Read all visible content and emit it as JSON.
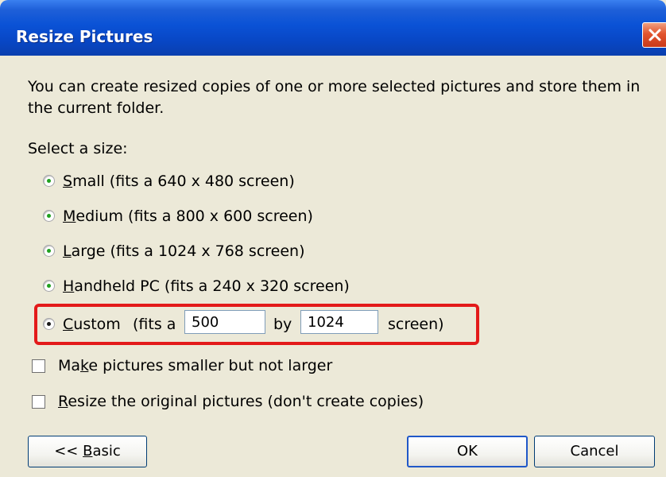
{
  "window": {
    "title": "Resize Pictures",
    "close_icon": "close-icon"
  },
  "description": {
    "line1": "You can create resized copies of one or more selected pictures and store them in",
    "line2": "the current folder."
  },
  "size_section": {
    "heading": "Select a size:",
    "options": [
      {
        "mnemonic": "S",
        "rest": "mall (fits a 640 x 480 screen)",
        "selected": false
      },
      {
        "mnemonic": "M",
        "rest": "edium (fits a 800 x 600 screen)",
        "selected": false
      },
      {
        "mnemonic": "L",
        "rest": "arge (fits a 1024 x 768 screen)",
        "selected": false
      },
      {
        "mnemonic": "H",
        "rest": "andheld PC (fits a 240 x 320 screen)",
        "selected": false
      }
    ],
    "custom": {
      "mnemonic": "C",
      "rest": "ustom",
      "prefix": "(fits a",
      "width_value": "500",
      "by_label": "by",
      "height_value": "1024",
      "suffix": "screen)",
      "selected": true
    }
  },
  "checkboxes": [
    {
      "before": "Ma",
      "mnemonic": "k",
      "after": "e pictures smaller but not larger",
      "checked": false
    },
    {
      "before": "",
      "mnemonic": "R",
      "after": "esize the original pictures (don't create copies)",
      "checked": false
    }
  ],
  "buttons": {
    "basic_prefix": "<< ",
    "basic_mnemonic": "B",
    "basic_rest": "asic",
    "ok": "OK",
    "cancel": "Cancel"
  },
  "colors": {
    "titlebar": "#0a52d6",
    "dialog_bg": "#ece9d8",
    "highlight_box": "#e31a1a",
    "radio_dot_selected": "#1a1a1a"
  }
}
